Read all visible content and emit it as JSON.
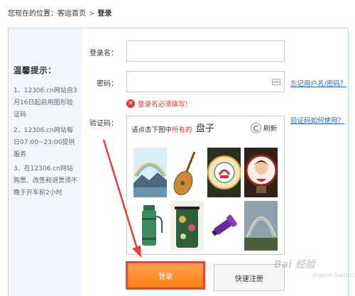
{
  "breadcrumb": {
    "prefix": "您现在的位置：",
    "home": "客运首页",
    "separator": ">",
    "current": "登录"
  },
  "tips": {
    "title": "温馨提示：",
    "items": [
      "1、12306.cn网站自3月16日起启用图形验证码",
      "2、12306.cn网站每日07:00~23:00提供服务",
      "3、在12306.cn网站购票、改签和退票须不晚于开车前2小时"
    ]
  },
  "form": {
    "username_label": "登录名：",
    "username_value": "",
    "password_label": "密码：",
    "password_value": "",
    "forgot_link": "忘记用户名/密码？",
    "error_text": "登录名必须填写！",
    "captcha_label": "验证码：",
    "captcha_help_link": "验证码如何使用？"
  },
  "captcha": {
    "prompt_before": "请点击下图中",
    "prompt_highlight": "所有的",
    "target_word": "盘子",
    "refresh_label": "刷新",
    "images": [
      "rainbow-landscape",
      "pipa-instrument",
      "decorative-plate",
      "portrait-plate",
      "thermos-bottle",
      "painted-vase",
      "purple-flashlight",
      "rainbow-field"
    ]
  },
  "buttons": {
    "login": "登录",
    "quick_register": "快速注册"
  },
  "watermark": {
    "main": "Bai 经验",
    "sub": "jingyan.baidu.com"
  },
  "colors": {
    "accent_orange": "#ff8a2a",
    "error_red": "#e03a2e",
    "link_blue": "#2a67b3",
    "highlight_border": "#e2473f"
  }
}
